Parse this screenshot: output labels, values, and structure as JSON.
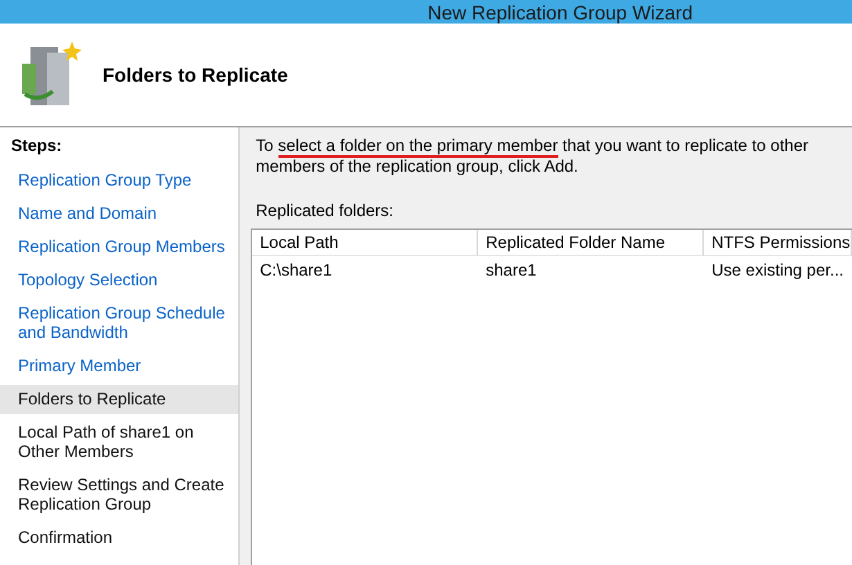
{
  "window": {
    "title": "New Replication Group Wizard"
  },
  "header": {
    "title": "Folders to Replicate"
  },
  "steps": {
    "heading": "Steps:",
    "items": [
      {
        "label": "Replication Group Type",
        "selected": false,
        "visited": true
      },
      {
        "label": "Name and Domain",
        "selected": false,
        "visited": true
      },
      {
        "label": "Replication Group Members",
        "selected": false,
        "visited": true
      },
      {
        "label": "Topology Selection",
        "selected": false,
        "visited": true
      },
      {
        "label": "Replication Group Schedule and Bandwidth",
        "selected": false,
        "visited": true
      },
      {
        "label": "Primary Member",
        "selected": false,
        "visited": true
      },
      {
        "label": "Folders to Replicate",
        "selected": true,
        "visited": false
      },
      {
        "label": "Local Path of share1 on Other Members",
        "selected": false,
        "visited": false
      },
      {
        "label": "Review Settings and Create Replication Group",
        "selected": false,
        "visited": false
      },
      {
        "label": "Confirmation",
        "selected": false,
        "visited": false
      }
    ]
  },
  "instruction": {
    "before": "To ",
    "underlined": "select a folder on the primary member",
    "after": " that you want to replicate to other members of the replication group, click Add."
  },
  "table": {
    "label": "Replicated folders:",
    "columns": [
      "Local Path",
      "Replicated Folder Name",
      "NTFS Permissions"
    ],
    "rows": [
      [
        "C:\\share1",
        "share1",
        "Use existing per..."
      ]
    ]
  }
}
